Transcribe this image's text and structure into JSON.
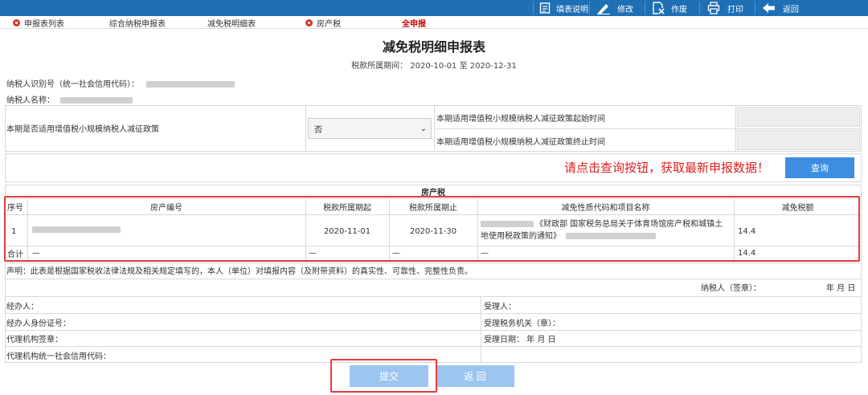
{
  "toolbar": {
    "items": [
      {
        "label": "填表说明",
        "icon": "document-icon"
      },
      {
        "label": "修改",
        "icon": "pencil-icon"
      },
      {
        "label": "作废",
        "icon": "void-icon"
      },
      {
        "label": "打印",
        "icon": "printer-icon"
      },
      {
        "label": "返回",
        "icon": "back-arrow-icon"
      }
    ]
  },
  "tabs": [
    {
      "label": "申报表列表"
    },
    {
      "label": "综合纳税申报表"
    },
    {
      "label": "减免税明细表"
    },
    {
      "label": "房产税"
    },
    {
      "label": "全申报"
    }
  ],
  "title": "减免税明细申报表",
  "period": "税款所属期间：  2020-10-01 至 2020-12-31",
  "taxpayer": {
    "id_label": "纳税人识别号（统一社会信用代码）：",
    "name_label": "纳税人名称："
  },
  "policy": {
    "question": "本期是否适用增值税小规模纳税人减征政策",
    "selected": "否",
    "start_label": "本期适用增值税小规模纳税人减征政策起始时间",
    "end_label": "本期适用增值税小规模纳税人减征政策终止时间"
  },
  "notice": "请点击查询按钮，获取最新申报数据！",
  "query_label": "查询",
  "table": {
    "section_title": "房产税",
    "headers": [
      "序号",
      "房产编号",
      "税款所属期起",
      "税款所属期止",
      "减免性质代码和项目名称",
      "减免税额"
    ],
    "row": {
      "index": "1",
      "start": "2020-11-01",
      "end": "2020-11-30",
      "policy_line1": "《财政部 国家税务总局关于体育场馆房产税和城镇土",
      "policy_line2": "地使用税政策的通知》",
      "amount": "14.4"
    },
    "total": {
      "label": "合计",
      "dash1": "—",
      "dash2": "—",
      "dash3": "—",
      "dash4": "—",
      "amount": "14.4"
    }
  },
  "declaration": "声明：此表是根据国家税收法律法规及相关规定填写的，本人（单位）对填报内容（及附带资料）的真实性、可靠性、完整性负责。",
  "signature": {
    "taxpayer_seal": "纳税人（签章）：",
    "date": "年 月 日"
  },
  "footer": {
    "handler": "经办人：",
    "handler_id": "经办人身份证号：",
    "agency_seal": "代理机构签章：",
    "agency_code": "代理机构统一社会信用代码：",
    "receiver": "受理人：",
    "receiving_office": "受理税务机关（章）：",
    "receive_date": "受理日期：   年 月 日"
  },
  "buttons": {
    "submit": "提交",
    "back": "返 回"
  }
}
